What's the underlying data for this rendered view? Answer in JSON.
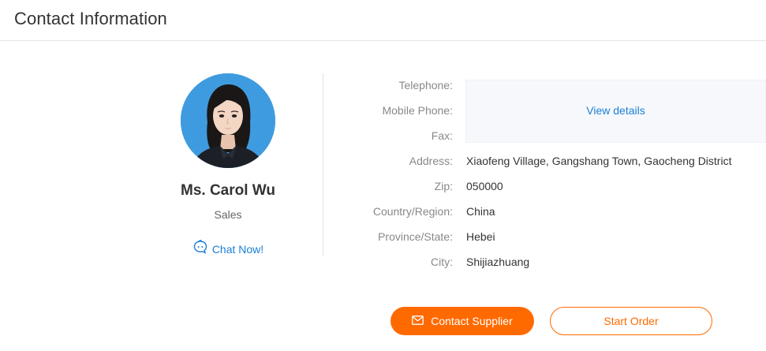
{
  "header": {
    "title": "Contact Information"
  },
  "profile": {
    "name": "Ms. Carol Wu",
    "title": "Sales",
    "chat_label": "Chat Now!"
  },
  "fields": {
    "telephone_label": "Telephone:",
    "mobile_label": "Mobile Phone:",
    "fax_label": "Fax:",
    "view_details": "View details",
    "address_label": "Address:",
    "address_value": "Xiaofeng Village, Gangshang Town, Gaocheng District",
    "zip_label": "Zip:",
    "zip_value": "050000",
    "country_label": "Country/Region:",
    "country_value": "China",
    "province_label": "Province/State:",
    "province_value": "Hebei",
    "city_label": "City:",
    "city_value": "Shijiazhuang"
  },
  "actions": {
    "contact_supplier": "Contact Supplier",
    "start_order": "Start Order"
  },
  "colors": {
    "accent": "#ff6a00",
    "link": "#1b7fd6",
    "avatar_bg": "#3f9be0"
  },
  "icons": {
    "chat": "chat-bubble-icon",
    "mail": "envelope-icon"
  }
}
